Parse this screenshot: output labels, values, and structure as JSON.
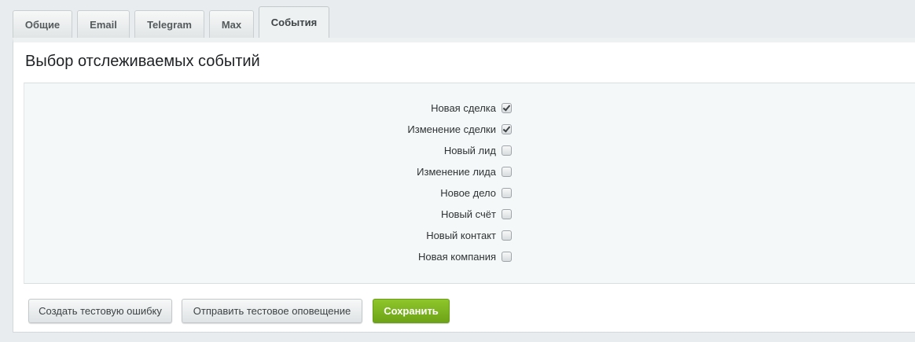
{
  "tabs": [
    {
      "label": "Общие",
      "active": false
    },
    {
      "label": "Email",
      "active": false
    },
    {
      "label": "Telegram",
      "active": false
    },
    {
      "label": "Max",
      "active": false
    },
    {
      "label": "События",
      "active": true
    }
  ],
  "panel": {
    "title": "Выбор отслеживаемых событий"
  },
  "events": [
    {
      "label": "Новая сделка",
      "checked": true
    },
    {
      "label": "Изменение сделки",
      "checked": true
    },
    {
      "label": "Новый лид",
      "checked": false
    },
    {
      "label": "Изменение лида",
      "checked": false
    },
    {
      "label": "Новое дело",
      "checked": false
    },
    {
      "label": "Новый счёт",
      "checked": false
    },
    {
      "label": "Новый контакт",
      "checked": false
    },
    {
      "label": "Новая компания",
      "checked": false
    }
  ],
  "buttons": {
    "test_error": "Создать тестовую ошибку",
    "test_notification": "Отправить тестовое оповещение",
    "save": "Сохранить"
  },
  "colors": {
    "save_button": "#7cb422",
    "page_background": "#e8ecee"
  }
}
